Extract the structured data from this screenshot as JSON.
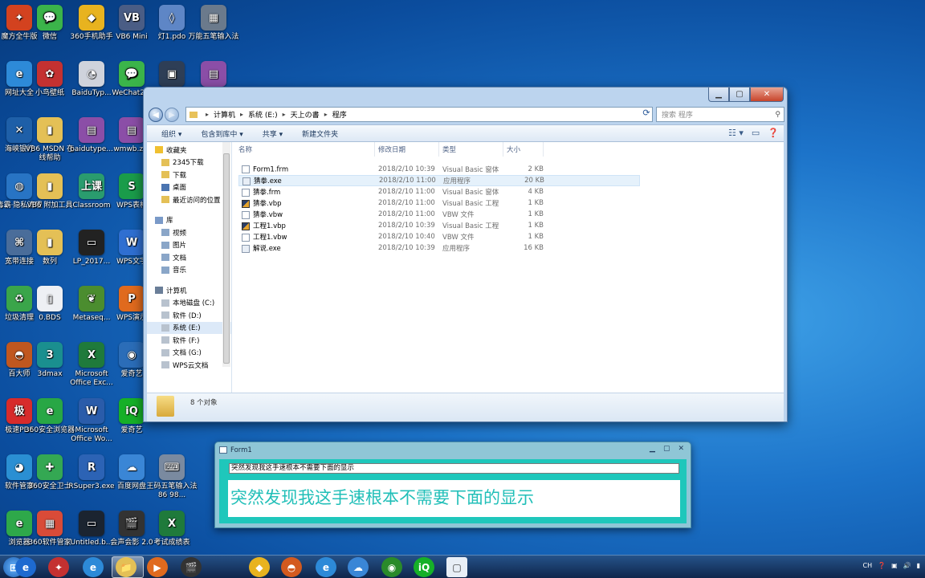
{
  "desktop_icons": [
    {
      "label": "魔方全牛版",
      "col": 0,
      "row": 0,
      "color": "#d3421f",
      "glyph": "✦"
    },
    {
      "label": "微信",
      "col": 1,
      "row": 0,
      "color": "#3bb44a",
      "glyph": "💬"
    },
    {
      "label": "360手机助手",
      "col": 2,
      "row": 0,
      "color": "#e8b31f",
      "glyph": "◆"
    },
    {
      "label": "VB6 Mini",
      "col": 3,
      "row": 0,
      "color": "#4a5d85",
      "glyph": "VB"
    },
    {
      "label": "灯1.pdo",
      "col": 4,
      "row": 0,
      "color": "#5e86c6",
      "glyph": "◊"
    },
    {
      "label": "万能五笔输入法",
      "col": 5,
      "row": 0,
      "color": "#6b7a8c",
      "glyph": "▦"
    },
    {
      "label": "网址大全",
      "col": 0,
      "row": 1,
      "color": "#2d8ad8",
      "glyph": "e"
    },
    {
      "label": "小鸟壁纸",
      "col": 1,
      "row": 1,
      "color": "#c43131",
      "glyph": "✿"
    },
    {
      "label": "BaiduTyp...",
      "col": 2,
      "row": 1,
      "color": "#cfd3dc",
      "glyph": "◔"
    },
    {
      "label": "WeChat2...",
      "col": 3,
      "row": 1,
      "color": "#3bb44a",
      "glyph": "💬"
    },
    {
      "label": "",
      "col": 4,
      "row": 1,
      "color": "#2e3e56",
      "glyph": "▣"
    },
    {
      "label": "",
      "col": 5,
      "row": 1,
      "color": "#8b4ea7",
      "glyph": "▤"
    },
    {
      "label": "海峡银行",
      "col": 0,
      "row": 2,
      "color": "#1e5fa8",
      "glyph": "✕"
    },
    {
      "label": "VB6 MSDN 在线帮助",
      "col": 1,
      "row": 2,
      "color": "#e4c056",
      "glyph": "▮"
    },
    {
      "label": "baidutype...",
      "col": 2,
      "row": 2,
      "color": "#8b4ea7",
      "glyph": "▤"
    },
    {
      "label": "wmwb.z...",
      "col": 3,
      "row": 2,
      "color": "#8b4ea7",
      "glyph": "▤"
    },
    {
      "label": "毒霸·隐私清理",
      "col": 0,
      "row": 3,
      "color": "#2874c4",
      "glyph": "◍"
    },
    {
      "label": "VB6 附加工具",
      "col": 1,
      "row": 3,
      "color": "#e4c056",
      "glyph": "▮"
    },
    {
      "label": "Classroom",
      "col": 2,
      "row": 3,
      "color": "#2a9c6e",
      "glyph": "上课"
    },
    {
      "label": "WPS表格",
      "col": 3,
      "row": 3,
      "color": "#1a9c4a",
      "glyph": "S"
    },
    {
      "label": "宽带连接",
      "col": 0,
      "row": 4,
      "color": "#4a6d9a",
      "glyph": "⌘"
    },
    {
      "label": "数列",
      "col": 1,
      "row": 4,
      "color": "#e4c056",
      "glyph": "▮"
    },
    {
      "label": "LP_2017...",
      "col": 2,
      "row": 4,
      "color": "#222",
      "glyph": "▭"
    },
    {
      "label": "WPS文字",
      "col": 3,
      "row": 4,
      "color": "#2f6fd1",
      "glyph": "W"
    },
    {
      "label": "垃圾清理",
      "col": 0,
      "row": 5,
      "color": "#3aa54a",
      "glyph": "♻"
    },
    {
      "label": "0.BDS",
      "col": 1,
      "row": 5,
      "color": "#eef0f4",
      "glyph": "▯"
    },
    {
      "label": "Metaseq...",
      "col": 2,
      "row": 5,
      "color": "#4b8d2f",
      "glyph": "❦"
    },
    {
      "label": "WPS演示",
      "col": 3,
      "row": 5,
      "color": "#e06a1e",
      "glyph": "P"
    },
    {
      "label": "百大师",
      "col": 0,
      "row": 6,
      "color": "#c0571f",
      "glyph": "◓"
    },
    {
      "label": "3dmax",
      "col": 1,
      "row": 6,
      "color": "#1a8f8f",
      "glyph": "3"
    },
    {
      "label": "Microsoft Office Exc...",
      "col": 2,
      "row": 6,
      "color": "#1f7a3b",
      "glyph": "X"
    },
    {
      "label": "爱奇艺",
      "col": 3,
      "row": 6,
      "color": "#2b6db8",
      "glyph": "◉"
    },
    {
      "label": "极速PDF",
      "col": 0,
      "row": 7,
      "color": "#d72b2b",
      "glyph": "极"
    },
    {
      "label": "360安全浏览器",
      "col": 1,
      "row": 7,
      "color": "#28a745",
      "glyph": "e"
    },
    {
      "label": "Microsoft Office Wo...",
      "col": 2,
      "row": 7,
      "color": "#2a5caa",
      "glyph": "W"
    },
    {
      "label": "爱奇艺",
      "col": 3,
      "row": 7,
      "color": "#16b028",
      "glyph": "iQ"
    },
    {
      "label": "软件管家",
      "col": 0,
      "row": 8,
      "color": "#2a8fd3",
      "glyph": "◕"
    },
    {
      "label": "360安全卫士",
      "col": 1,
      "row": 8,
      "color": "#34a853",
      "glyph": "✚"
    },
    {
      "label": "RSuper3.exe",
      "col": 2,
      "row": 8,
      "color": "#2c63b5",
      "glyph": "R"
    },
    {
      "label": "百度网盘",
      "col": 3,
      "row": 8,
      "color": "#3a86d6",
      "glyph": "☁"
    },
    {
      "label": "王码五笔输入法86 98...",
      "col": 4,
      "row": 8,
      "color": "#7a8aa0",
      "glyph": "⌨"
    },
    {
      "label": "浏览器",
      "col": 0,
      "row": 9,
      "color": "#2ea84a",
      "glyph": "e"
    },
    {
      "label": "360软件管家",
      "col": 1,
      "row": 9,
      "color": "#d94b38",
      "glyph": "▦"
    },
    {
      "label": "Untitled.b...",
      "col": 2,
      "row": 9,
      "color": "#1b2430",
      "glyph": "▭"
    },
    {
      "label": "会声会影 2.0",
      "col": 3,
      "row": 9,
      "color": "#333",
      "glyph": "🎬"
    },
    {
      "label": "考试成绩表",
      "col": 4,
      "row": 9,
      "color": "#1f7a3b",
      "glyph": "X"
    }
  ],
  "explorer": {
    "address": [
      "计算机",
      "系统 (E:)",
      "天上の書",
      "程序"
    ],
    "search_placeholder": "搜索 程序",
    "toolbar": [
      "组织 ▾",
      "包含到库中 ▾",
      "共享 ▾",
      "新建文件夹"
    ],
    "nav": {
      "favorites_title": "收藏夹",
      "favorites": [
        "2345下载",
        "下载",
        "桌面",
        "最近访问的位置"
      ],
      "libraries_title": "库",
      "libraries": [
        "视频",
        "图片",
        "文档",
        "音乐"
      ],
      "computer_title": "计算机",
      "drives": [
        "本地磁盘 (C:)",
        "软件 (D:)",
        "系统 (E:)",
        "软件 (F:)",
        "文档 (G:)",
        "WPS云文档"
      ]
    },
    "columns": [
      "名称",
      "修改日期",
      "类型",
      "大小"
    ],
    "files": [
      {
        "name": "Form1.frm",
        "date": "2018/2/10 10:39",
        "type": "Visual Basic 窗体",
        "size": "2 KB",
        "icon": "doc"
      },
      {
        "name": "猜拳.exe",
        "date": "2018/2/10 11:00",
        "type": "应用程序",
        "size": "20 KB",
        "icon": "exe"
      },
      {
        "name": "猜拳.frm",
        "date": "2018/2/10 11:00",
        "type": "Visual Basic 窗体",
        "size": "4 KB",
        "icon": "doc"
      },
      {
        "name": "猜拳.vbp",
        "date": "2018/2/10 11:00",
        "type": "Visual Basic 工程",
        "size": "1 KB",
        "icon": "vbp"
      },
      {
        "name": "猜拳.vbw",
        "date": "2018/2/10 11:00",
        "type": "VBW 文件",
        "size": "1 KB",
        "icon": "doc"
      },
      {
        "name": "工程1.vbp",
        "date": "2018/2/10 10:39",
        "type": "Visual Basic 工程",
        "size": "1 KB",
        "icon": "vbp"
      },
      {
        "name": "工程1.vbw",
        "date": "2018/2/10 10:40",
        "type": "VBW 文件",
        "size": "1 KB",
        "icon": "doc"
      },
      {
        "name": "解说.exe",
        "date": "2018/2/10 10:39",
        "type": "应用程序",
        "size": "16 KB",
        "icon": "exe"
      }
    ],
    "status": "8 个对象"
  },
  "form1": {
    "title": "Form1",
    "textbox": "突然发现我这手速根本不需要下面的显示",
    "label": "突然发现我这手速根本不需要下面的显示"
  },
  "taskbar": {
    "apps": [
      "e",
      "✦",
      "e",
      "📁",
      "▶",
      "🎬",
      "◆",
      "◓",
      "e",
      "☁",
      "◉",
      "iQ",
      "▢"
    ],
    "tray_text": "CH"
  }
}
